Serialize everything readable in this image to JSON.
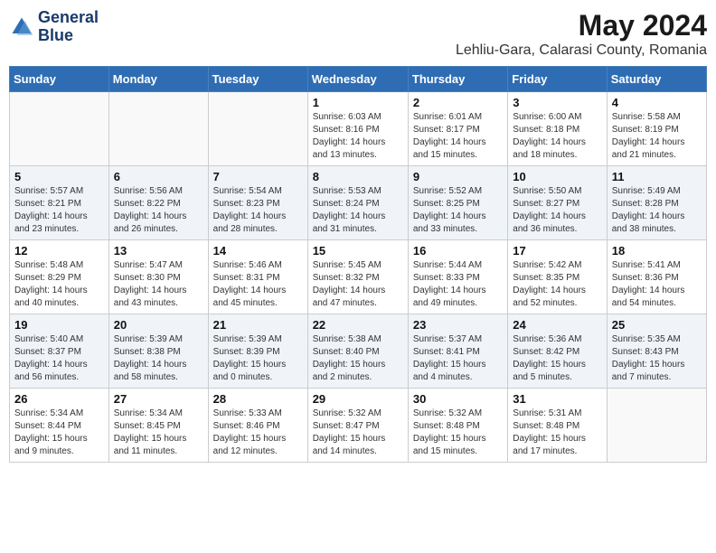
{
  "header": {
    "logo_line1": "General",
    "logo_line2": "Blue",
    "month_year": "May 2024",
    "location": "Lehliu-Gara, Calarasi County, Romania"
  },
  "days_of_week": [
    "Sunday",
    "Monday",
    "Tuesday",
    "Wednesday",
    "Thursday",
    "Friday",
    "Saturday"
  ],
  "weeks": [
    [
      {
        "day": "",
        "info": ""
      },
      {
        "day": "",
        "info": ""
      },
      {
        "day": "",
        "info": ""
      },
      {
        "day": "1",
        "info": "Sunrise: 6:03 AM\nSunset: 8:16 PM\nDaylight: 14 hours\nand 13 minutes."
      },
      {
        "day": "2",
        "info": "Sunrise: 6:01 AM\nSunset: 8:17 PM\nDaylight: 14 hours\nand 15 minutes."
      },
      {
        "day": "3",
        "info": "Sunrise: 6:00 AM\nSunset: 8:18 PM\nDaylight: 14 hours\nand 18 minutes."
      },
      {
        "day": "4",
        "info": "Sunrise: 5:58 AM\nSunset: 8:19 PM\nDaylight: 14 hours\nand 21 minutes."
      }
    ],
    [
      {
        "day": "5",
        "info": "Sunrise: 5:57 AM\nSunset: 8:21 PM\nDaylight: 14 hours\nand 23 minutes."
      },
      {
        "day": "6",
        "info": "Sunrise: 5:56 AM\nSunset: 8:22 PM\nDaylight: 14 hours\nand 26 minutes."
      },
      {
        "day": "7",
        "info": "Sunrise: 5:54 AM\nSunset: 8:23 PM\nDaylight: 14 hours\nand 28 minutes."
      },
      {
        "day": "8",
        "info": "Sunrise: 5:53 AM\nSunset: 8:24 PM\nDaylight: 14 hours\nand 31 minutes."
      },
      {
        "day": "9",
        "info": "Sunrise: 5:52 AM\nSunset: 8:25 PM\nDaylight: 14 hours\nand 33 minutes."
      },
      {
        "day": "10",
        "info": "Sunrise: 5:50 AM\nSunset: 8:27 PM\nDaylight: 14 hours\nand 36 minutes."
      },
      {
        "day": "11",
        "info": "Sunrise: 5:49 AM\nSunset: 8:28 PM\nDaylight: 14 hours\nand 38 minutes."
      }
    ],
    [
      {
        "day": "12",
        "info": "Sunrise: 5:48 AM\nSunset: 8:29 PM\nDaylight: 14 hours\nand 40 minutes."
      },
      {
        "day": "13",
        "info": "Sunrise: 5:47 AM\nSunset: 8:30 PM\nDaylight: 14 hours\nand 43 minutes."
      },
      {
        "day": "14",
        "info": "Sunrise: 5:46 AM\nSunset: 8:31 PM\nDaylight: 14 hours\nand 45 minutes."
      },
      {
        "day": "15",
        "info": "Sunrise: 5:45 AM\nSunset: 8:32 PM\nDaylight: 14 hours\nand 47 minutes."
      },
      {
        "day": "16",
        "info": "Sunrise: 5:44 AM\nSunset: 8:33 PM\nDaylight: 14 hours\nand 49 minutes."
      },
      {
        "day": "17",
        "info": "Sunrise: 5:42 AM\nSunset: 8:35 PM\nDaylight: 14 hours\nand 52 minutes."
      },
      {
        "day": "18",
        "info": "Sunrise: 5:41 AM\nSunset: 8:36 PM\nDaylight: 14 hours\nand 54 minutes."
      }
    ],
    [
      {
        "day": "19",
        "info": "Sunrise: 5:40 AM\nSunset: 8:37 PM\nDaylight: 14 hours\nand 56 minutes."
      },
      {
        "day": "20",
        "info": "Sunrise: 5:39 AM\nSunset: 8:38 PM\nDaylight: 14 hours\nand 58 minutes."
      },
      {
        "day": "21",
        "info": "Sunrise: 5:39 AM\nSunset: 8:39 PM\nDaylight: 15 hours\nand 0 minutes."
      },
      {
        "day": "22",
        "info": "Sunrise: 5:38 AM\nSunset: 8:40 PM\nDaylight: 15 hours\nand 2 minutes."
      },
      {
        "day": "23",
        "info": "Sunrise: 5:37 AM\nSunset: 8:41 PM\nDaylight: 15 hours\nand 4 minutes."
      },
      {
        "day": "24",
        "info": "Sunrise: 5:36 AM\nSunset: 8:42 PM\nDaylight: 15 hours\nand 5 minutes."
      },
      {
        "day": "25",
        "info": "Sunrise: 5:35 AM\nSunset: 8:43 PM\nDaylight: 15 hours\nand 7 minutes."
      }
    ],
    [
      {
        "day": "26",
        "info": "Sunrise: 5:34 AM\nSunset: 8:44 PM\nDaylight: 15 hours\nand 9 minutes."
      },
      {
        "day": "27",
        "info": "Sunrise: 5:34 AM\nSunset: 8:45 PM\nDaylight: 15 hours\nand 11 minutes."
      },
      {
        "day": "28",
        "info": "Sunrise: 5:33 AM\nSunset: 8:46 PM\nDaylight: 15 hours\nand 12 minutes."
      },
      {
        "day": "29",
        "info": "Sunrise: 5:32 AM\nSunset: 8:47 PM\nDaylight: 15 hours\nand 14 minutes."
      },
      {
        "day": "30",
        "info": "Sunrise: 5:32 AM\nSunset: 8:48 PM\nDaylight: 15 hours\nand 15 minutes."
      },
      {
        "day": "31",
        "info": "Sunrise: 5:31 AM\nSunset: 8:48 PM\nDaylight: 15 hours\nand 17 minutes."
      },
      {
        "day": "",
        "info": ""
      }
    ]
  ]
}
